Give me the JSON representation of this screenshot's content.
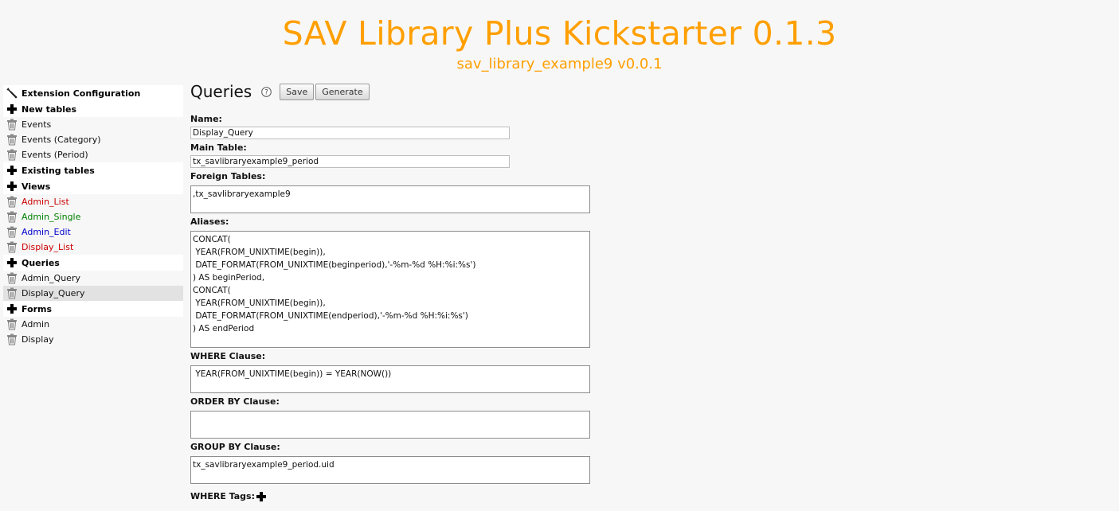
{
  "header": {
    "title": "SAV Library Plus Kickstarter 0.1.3",
    "subtitle": "sav_library_example9 v0.0.1"
  },
  "sidebar": {
    "items": [
      {
        "label": "Extension Configuration",
        "type": "section",
        "icon": "wrench-icon"
      },
      {
        "label": "New tables",
        "type": "section",
        "icon": "plus-icon"
      },
      {
        "label": "Events",
        "type": "item",
        "icon": "trash-icon",
        "color": "#111111"
      },
      {
        "label": "Events (Category)",
        "type": "item",
        "icon": "trash-icon",
        "color": "#111111"
      },
      {
        "label": "Events (Period)",
        "type": "item",
        "icon": "trash-icon",
        "color": "#111111"
      },
      {
        "label": "Existing tables",
        "type": "section",
        "icon": "plus-icon"
      },
      {
        "label": "Views",
        "type": "section",
        "icon": "plus-icon"
      },
      {
        "label": "Admin_List",
        "type": "item",
        "icon": "trash-icon",
        "color": "#cc0000"
      },
      {
        "label": "Admin_Single",
        "type": "item",
        "icon": "trash-icon",
        "color": "#008000"
      },
      {
        "label": "Admin_Edit",
        "type": "item",
        "icon": "trash-icon",
        "color": "#0000cc"
      },
      {
        "label": "Display_List",
        "type": "item",
        "icon": "trash-icon",
        "color": "#cc0000"
      },
      {
        "label": "Queries",
        "type": "section",
        "icon": "plus-icon"
      },
      {
        "label": "Admin_Query",
        "type": "item",
        "icon": "trash-icon",
        "color": "#111111"
      },
      {
        "label": "Display_Query",
        "type": "item",
        "icon": "trash-icon",
        "color": "#111111",
        "selected": true
      },
      {
        "label": "Forms",
        "type": "section",
        "icon": "plus-icon"
      },
      {
        "label": "Admin",
        "type": "item",
        "icon": "trash-icon",
        "color": "#111111"
      },
      {
        "label": "Display",
        "type": "item",
        "icon": "trash-icon",
        "color": "#111111"
      }
    ]
  },
  "main": {
    "title": "Queries",
    "help_icon": "help-icon",
    "save_label": "Save",
    "generate_label": "Generate",
    "name_label": "Name:",
    "name_value": "Display_Query",
    "main_table_label": "Main Table:",
    "main_table_value": "tx_savlibraryexample9_period",
    "foreign_tables_label": "Foreign Tables:",
    "foreign_tables_value": ",tx_savlibraryexample9",
    "aliases_label": "Aliases:",
    "aliases_value": "CONCAT(\n YEAR(FROM_UNIXTIME(begin)),\n DATE_FORMAT(FROM_UNIXTIME(beginperiod),'-%m-%d %H:%i:%s')\n) AS beginPeriod,\nCONCAT(\n YEAR(FROM_UNIXTIME(begin)),\n DATE_FORMAT(FROM_UNIXTIME(endperiod),'-%m-%d %H:%i:%s')\n) AS endPeriod",
    "where_label": "WHERE Clause:",
    "where_value": " YEAR(FROM_UNIXTIME(begin)) = YEAR(NOW())",
    "order_by_label": "ORDER BY Clause:",
    "order_by_value": "",
    "group_by_label": "GROUP BY Clause:",
    "group_by_value": "tx_savlibraryexample9_period.uid",
    "where_tags_label": "WHERE Tags:"
  },
  "colors": {
    "accent": "#ff9f00",
    "background": "#f7f7f7",
    "selected_row": "#e2e2e2"
  }
}
